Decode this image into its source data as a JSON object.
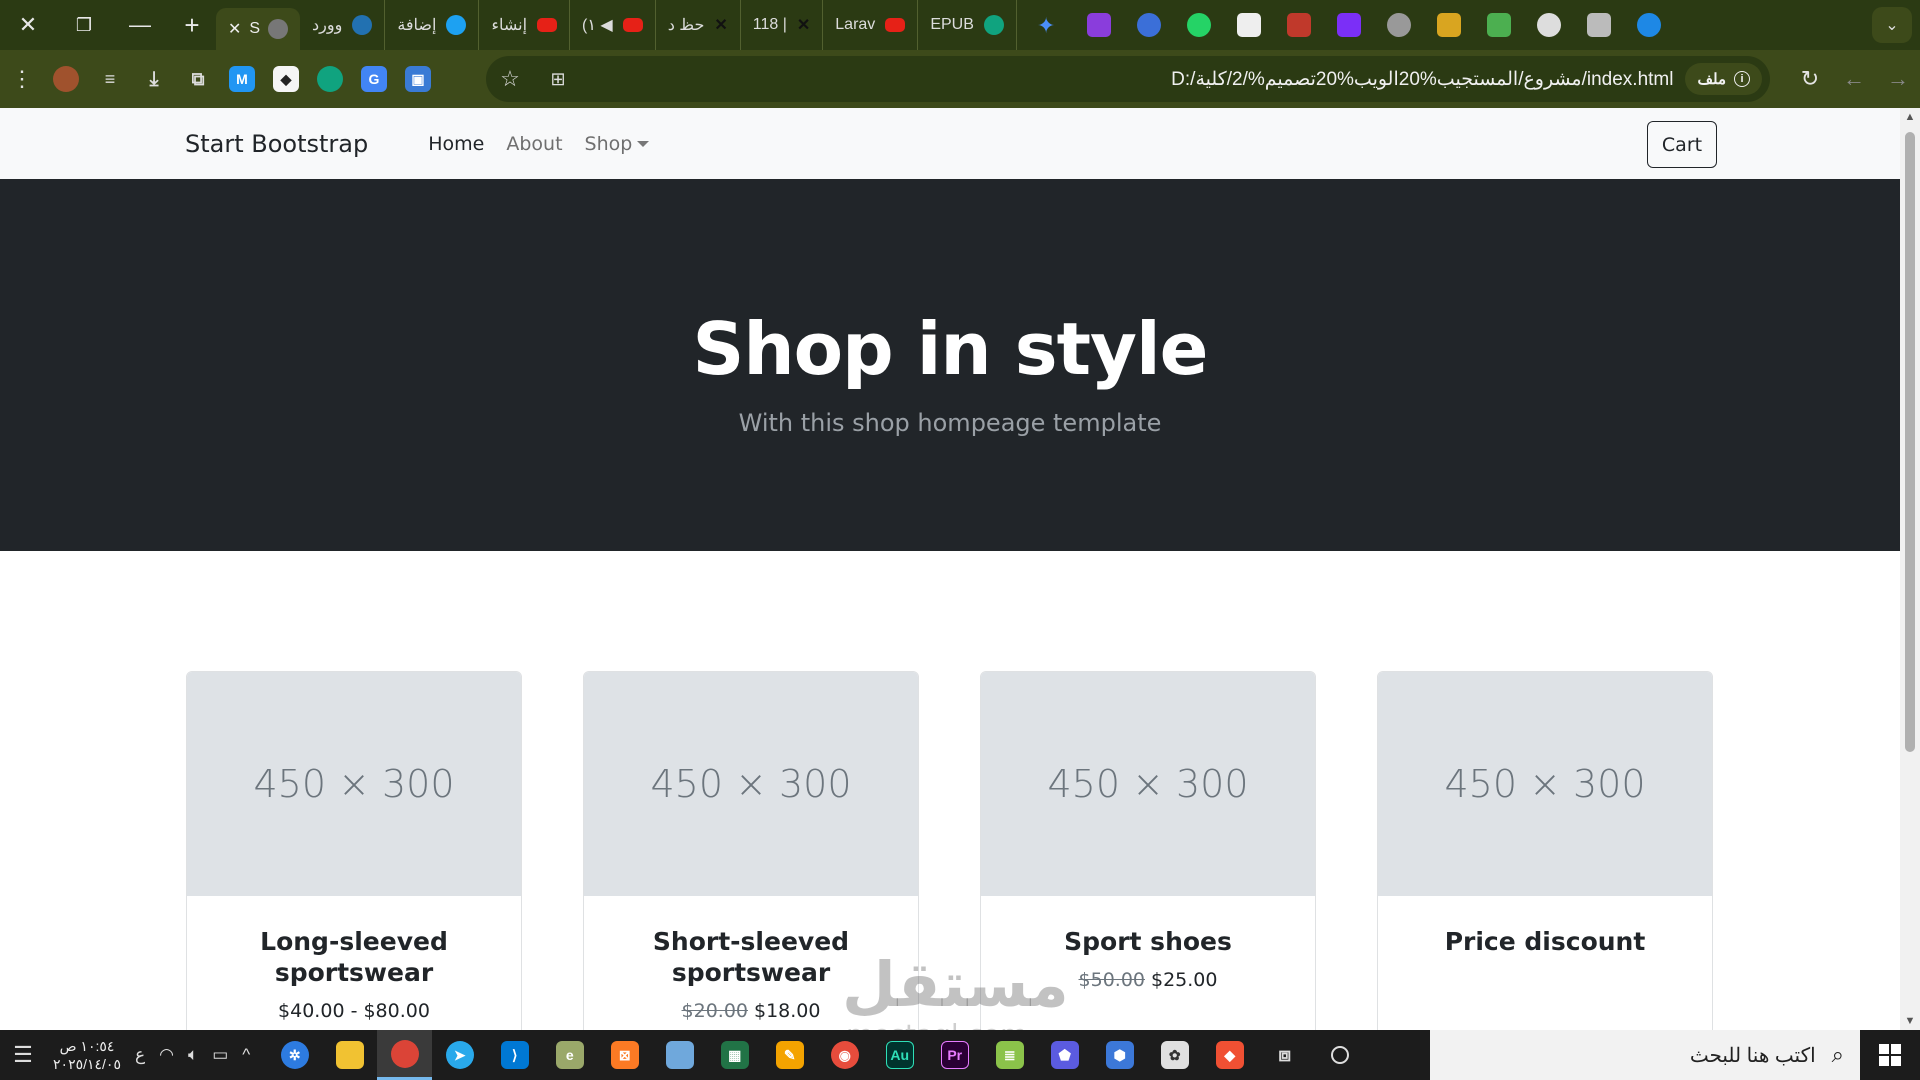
{
  "browser": {
    "tabs": [
      {
        "label": "وورد",
        "fav": "wordpress-icon",
        "color": "#2271b1"
      },
      {
        "label": "إضافة",
        "fav": "circle-icon",
        "color": "#1da1f2"
      },
      {
        "label": "إنشاء",
        "fav": "youtube-icon",
        "color": "#e62117"
      },
      {
        "label": "(١ ◀",
        "fav": "youtube-icon",
        "color": "#e62117"
      },
      {
        "label": "حظ د",
        "fav": "x-icon",
        "color": "#111111"
      },
      {
        "label": "118 |",
        "fav": "x-icon",
        "color": "#111111"
      },
      {
        "label": "Larav",
        "fav": "youtube-icon",
        "color": "#e62117"
      },
      {
        "label": "EPUB",
        "fav": "chatgpt-icon",
        "color": "#10a37f"
      }
    ],
    "active_tab_label": "S",
    "url": "D:/مشروع/المستجيب%20الويب%20تصميم%/2/كلية/index.html",
    "chip_label": "ملف"
  },
  "navbar": {
    "brand": "Start Bootstrap",
    "links": [
      "Home",
      "About",
      "Shop"
    ],
    "cart_label": "Cart"
  },
  "hero": {
    "title": "Shop in style",
    "subtitle": "With this shop hompeage template"
  },
  "products": [
    {
      "image_text": "450 × 300",
      "title": "Long-sleeved sportswear",
      "price": "$40.00 - $80.00",
      "old_price": ""
    },
    {
      "image_text": "450 × 300",
      "title": "Short-sleeved sportswear",
      "price": "$18.00",
      "old_price": "$20.00"
    },
    {
      "image_text": "450 × 300",
      "title": "Sport shoes",
      "price": "$25.00",
      "old_price": "$50.00"
    },
    {
      "image_text": "450 × 300",
      "title": "Price discount",
      "price": "",
      "old_price": ""
    }
  ],
  "watermark": {
    "text": "مستقل",
    "sub": "mostaql.com"
  },
  "taskbar": {
    "time": "١٠:٥٤ ص",
    "date": "٢٠٢٥/١٤/٠٥",
    "lang": "ع",
    "search_placeholder": "اكتب هنا للبحث"
  }
}
